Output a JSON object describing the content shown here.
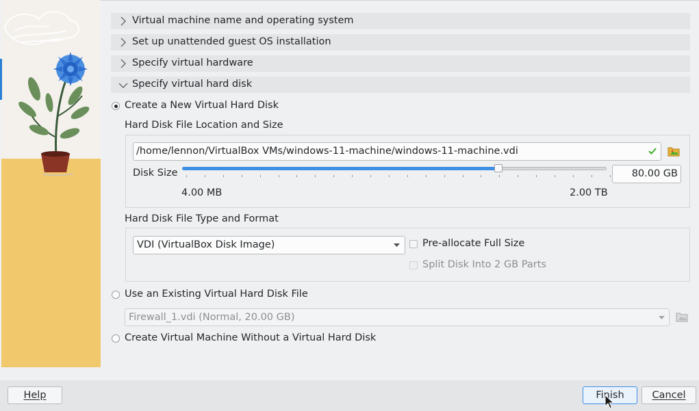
{
  "sections": [
    {
      "label": "Virtual machine name and operating system",
      "expanded": false
    },
    {
      "label": "Set up unattended guest OS installation",
      "expanded": false
    },
    {
      "label": "Specify virtual hardware",
      "expanded": false
    },
    {
      "label": "Specify virtual hard disk",
      "expanded": true
    }
  ],
  "create_new": {
    "label": "Create a New Virtual Hard Disk",
    "selected": true,
    "location_group_title": "Hard Disk File Location and Size",
    "path_value": "/home/lennon/VirtualBox VMs/windows-11-machine/windows-11-machine.vdi",
    "disk_size_label": "Disk Size",
    "disk_size_value": "80.00 GB",
    "slider_min_label": "4.00 MB",
    "slider_max_label": "2.00 TB",
    "slider_fraction": 0.745,
    "type_group_title": "Hard Disk File Type and Format",
    "format_value": "VDI (VirtualBox Disk Image)",
    "preallocate_label": "Pre-allocate Full Size",
    "split_label": "Split Disk Into 2 GB Parts"
  },
  "use_existing": {
    "label": "Use an Existing Virtual Hard Disk File",
    "selected": false,
    "file_value": "Firewall_1.vdi (Normal, 20.00 GB)"
  },
  "no_disk": {
    "label": "Create Virtual Machine Without a Virtual Hard Disk",
    "selected": false
  },
  "buttons": {
    "help": "Help",
    "finish": "Finish",
    "cancel": "Cancel"
  },
  "colors": {
    "accent": "#3d8ee5",
    "valid_check": "#3fae2a",
    "folder_icon": "#e8b63a"
  },
  "icons": [
    "chevron-right-icon",
    "chevron-down-icon",
    "check-icon",
    "folder-open-icon",
    "combo-arrow-icon",
    "mouse-cursor-icon"
  ]
}
